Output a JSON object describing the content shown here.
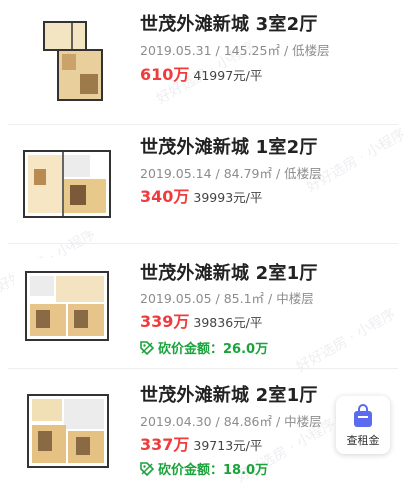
{
  "listings": [
    {
      "title": "世茂外滩新城 3室2厅",
      "meta": "2019.05.31 / 145.25㎡ / 低楼层",
      "price": "610万",
      "unit_price": "41997元/平"
    },
    {
      "title": "世茂外滩新城 1室2厅",
      "meta": "2019.05.14 / 84.79㎡ / 低楼层",
      "price": "340万",
      "unit_price": "39993元/平"
    },
    {
      "title": "世茂外滩新城 2室1厅",
      "meta": "2019.05.05 / 85.1㎡ / 中楼层",
      "price": "339万",
      "unit_price": "39836元/平",
      "discount": "砍价金额：26.0万"
    },
    {
      "title": "世茂外滩新城 2室1厅",
      "meta": "2019.04.30 / 84.86㎡ / 中楼层",
      "price": "337万",
      "unit_price": "39713元/平",
      "discount": "砍价金额：18.0万"
    }
  ],
  "float_button": {
    "label": "查租金",
    "icon": "shopping-bag-icon"
  },
  "watermark": "好好选房 · 小程序",
  "colors": {
    "price": "#ef3b3b",
    "discount": "#1aa33a",
    "float_icon": "#5b6bf0"
  }
}
